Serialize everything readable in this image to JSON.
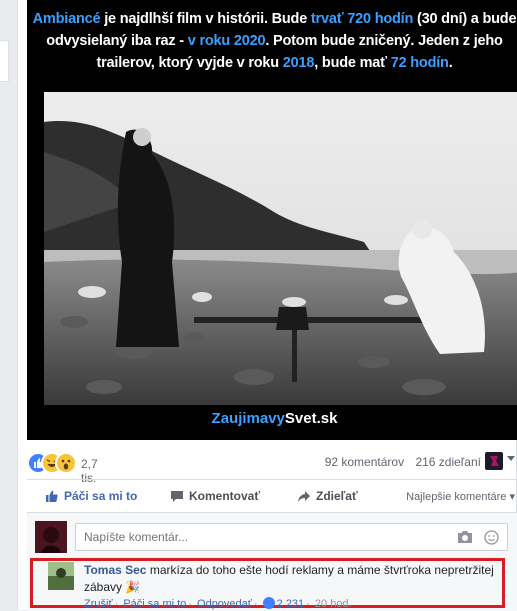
{
  "post": {
    "caption": {
      "p1": "Ambiancé",
      "p2": " je najdlhší film v histórii. Bude ",
      "p3": "trvať 720 hodín",
      "p4": " (30 dní) a bude odvysielaný iba raz - ",
      "p5": "v roku 2020",
      "p6": ". Potom bude zničený. Jeden z jeho trailerov, ktorý vyjde v roku ",
      "p7": "2018",
      "p8": ", bude mať ",
      "p9": "72 hodín",
      "p10": "."
    },
    "site_part1": "Zaujimavy",
    "site_part2": "Svet.sk"
  },
  "reactions": {
    "count": "2,7 tis.",
    "comments": "92 komentárov",
    "shares": "216 zdieľaní",
    "icons": [
      "like-icon",
      "haha-icon",
      "wow-icon"
    ]
  },
  "actions": {
    "like": "Páči sa mi to",
    "comment": "Komentovať",
    "share": "Zdieľať",
    "sort": "Najlepšie komentáre"
  },
  "composer": {
    "placeholder": "Napíšte komentár..."
  },
  "comment": {
    "author": "Tomas Sec",
    "text": " markíza do toho ešte hodí reklamy a máme štvrťroka nepretržitej zábavy 🎉",
    "actions": {
      "cancel": "Zrušiť",
      "like": "Páči sa mi to",
      "reply": "Odpovedať",
      "likes": "2 231",
      "time": "20 hod."
    }
  },
  "colors": {
    "accent": "#4267b2",
    "caption_highlight": "#3aa0ff",
    "highlight_border": "#d91c22"
  }
}
